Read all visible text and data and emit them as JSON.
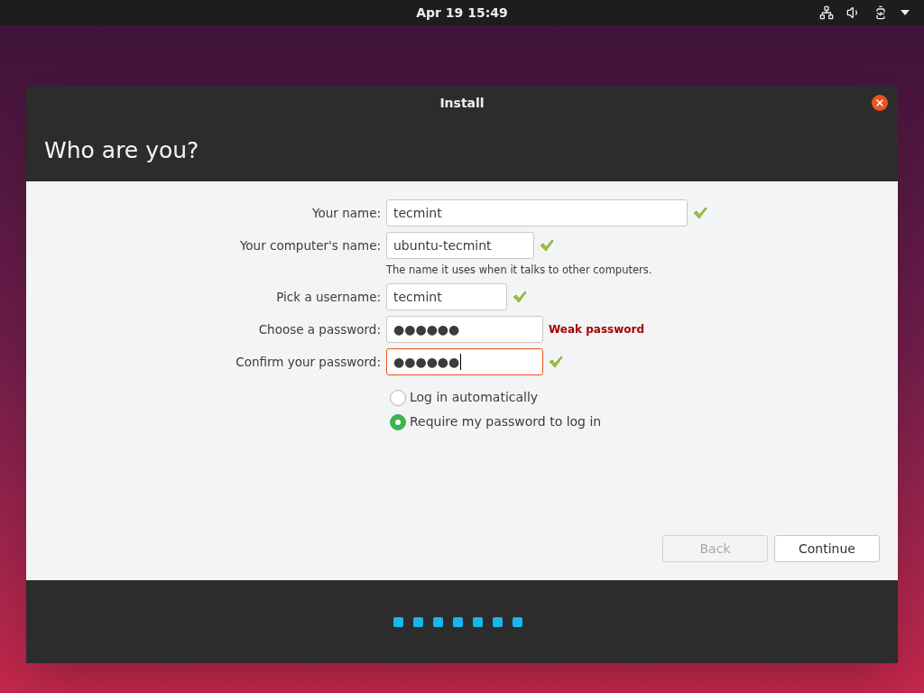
{
  "top_bar": {
    "clock": "Apr 19  15:49"
  },
  "window": {
    "title": "Install",
    "heading": "Who are you?"
  },
  "fields": [
    {
      "label": "Your name:",
      "value": "tecmint",
      "kind": "check",
      "focused": false
    },
    {
      "label": "Your computer's name:",
      "value": "ubuntu-tecmint",
      "kind": "check",
      "focused": false,
      "hint": "The name it uses when it talks to other computers."
    },
    {
      "label": "Pick a username:",
      "value": "tecmint",
      "kind": "check",
      "focused": false
    },
    {
      "label": "Choose a password:",
      "value": "●●●●●●",
      "kind": "warning",
      "status_text": "Weak password",
      "focused": false
    },
    {
      "label": "Confirm your password:",
      "value": "●●●●●●",
      "kind": "check",
      "focused": true
    }
  ],
  "login_options": [
    {
      "label": "Log in automatically",
      "selected": false
    },
    {
      "label": "Require my password to log in",
      "selected": true
    }
  ],
  "buttons": [
    {
      "label": "Back",
      "disabled": true
    },
    {
      "label": "Continue",
      "disabled": false
    }
  ]
}
